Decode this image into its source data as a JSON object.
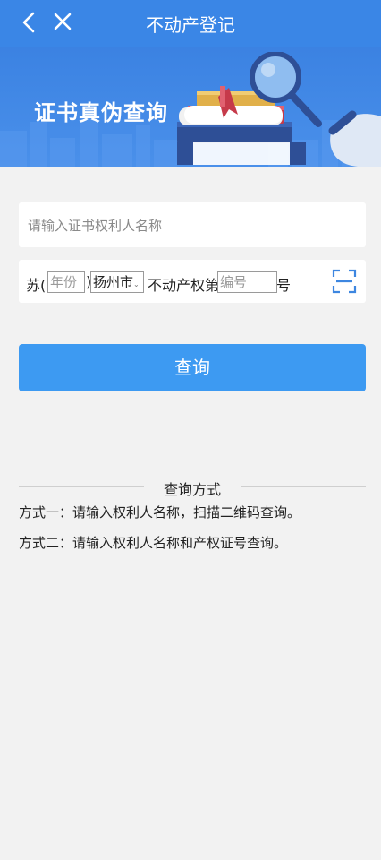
{
  "topbar": {
    "title": "不动产登记",
    "back_icon": "chevron-left-icon",
    "close_icon": "close-icon",
    "color": "#3a86e6"
  },
  "banner": {
    "title": "证书真伪查询",
    "illustration": "books-certificate-magnifier"
  },
  "form": {
    "name_placeholder": "请输入证书权利人名称",
    "prefix": "苏(",
    "year_placeholder": "年份",
    "close_paren": ")",
    "city": "扬州市",
    "middle_text": "不动产权第",
    "number_placeholder": "编号",
    "suffix": "号",
    "scan_icon": "scan-icon"
  },
  "query_button": {
    "label": "查询",
    "color": "#3d9af2"
  },
  "methods": {
    "title": "查询方式",
    "items": [
      "方式一：请输入权利人名称，扫描二维码查询。",
      "方式二：请输入权利人名称和产权证号查询。"
    ]
  }
}
